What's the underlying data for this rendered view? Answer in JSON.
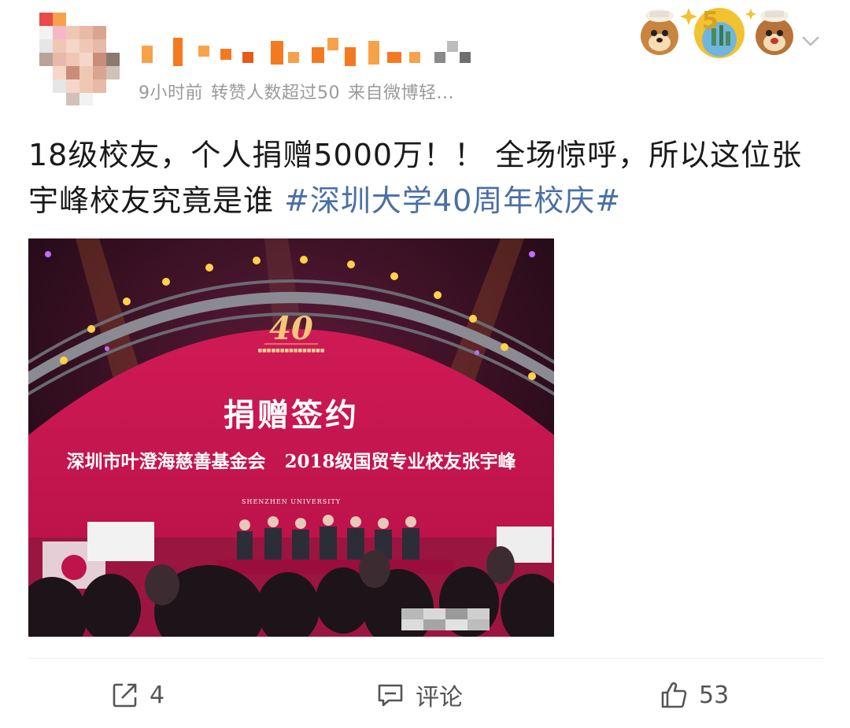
{
  "post": {
    "meta": {
      "time": "9小时前",
      "repost_threshold": "转赞人数超过50",
      "source": "来自微博轻..."
    },
    "text": "18级校友，个人捐赠5000万！！ 全场惊呼，所以这位张宇峰校友究竟是谁 ",
    "hashtag": "#深圳大学40周年校庆#"
  },
  "photo": {
    "stage_title": "捐赠签约",
    "stage_subtitle_left": "深圳市叶澄海慈善基金会",
    "stage_subtitle_right": "2018级国贸专业校友张宇峰",
    "logo_number": "40",
    "university_label": "SHENZHEN UNIVERSITY"
  },
  "actions": {
    "repost_count": "4",
    "comment_label": "评论",
    "like_count": "53"
  },
  "colors": {
    "hashtag": "#4a6fa5",
    "meta": "#9a9a9a",
    "stage": "#c8144f"
  }
}
